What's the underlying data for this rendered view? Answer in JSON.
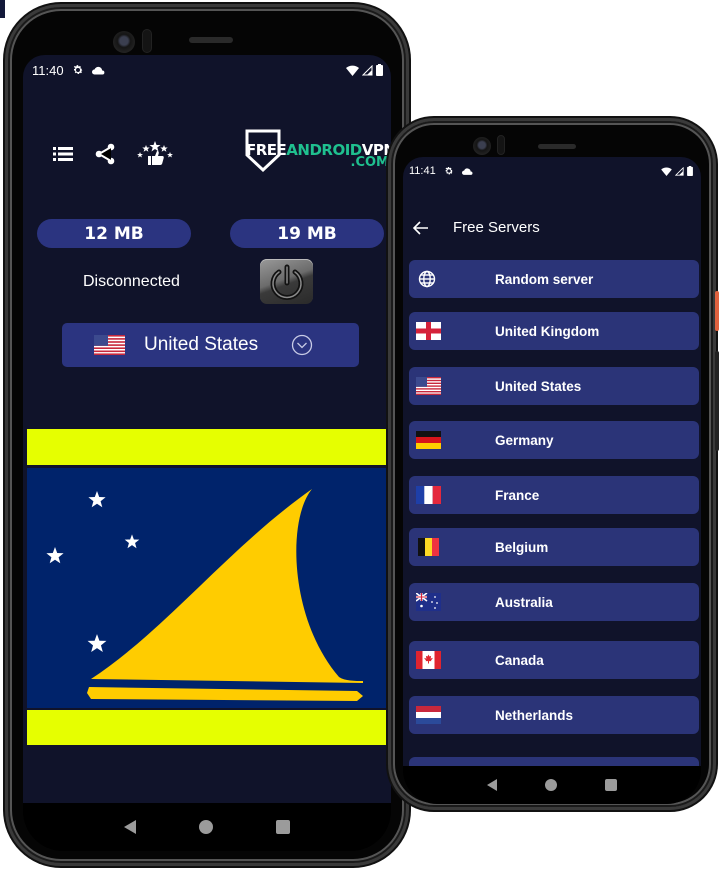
{
  "colors": {
    "screen_bg": "#10132a",
    "accent_blue": "#2b3480",
    "logo_green": "#1fc08f",
    "flag_yellow_bar": "#e6ff00",
    "flag_blue": "#00236b",
    "flag_gold": "#ffcc00"
  },
  "phone_main": {
    "statusbar": {
      "time": "11:40",
      "icons": [
        "settings-icon",
        "cloud-icon",
        "wifi-icon",
        "signal-icon",
        "battery-icon"
      ]
    },
    "toolbar": {
      "icons": [
        "list-icon",
        "share-icon",
        "rate-icon"
      ]
    },
    "logo": {
      "part1": "FREE",
      "part2": "ANDROID",
      "part3": "VPN",
      "suffix": ".COM"
    },
    "stats": {
      "download": "12 MB",
      "upload": "19 MB"
    },
    "connection_status": "Disconnected",
    "power_icon": "power-icon",
    "selected_country": {
      "name": "United States",
      "flag": "us-flag"
    },
    "displayed_flag": "tokelau-flag",
    "navbar": [
      "back",
      "home",
      "recents"
    ]
  },
  "phone_servers": {
    "statusbar": {
      "time": "11:41"
    },
    "header": {
      "title": "Free Servers",
      "back_icon": "arrow-left-icon"
    },
    "servers": [
      {
        "label": "Random server",
        "icon": "globe-icon"
      },
      {
        "label": "United Kingdom",
        "icon": "england-flag"
      },
      {
        "label": "United States",
        "icon": "us-flag"
      },
      {
        "label": "Germany",
        "icon": "germany-flag"
      },
      {
        "label": "France",
        "icon": "france-flag"
      },
      {
        "label": "Belgium",
        "icon": "belgium-flag"
      },
      {
        "label": "Australia",
        "icon": "australia-flag"
      },
      {
        "label": "Canada",
        "icon": "canada-flag"
      },
      {
        "label": "Netherlands",
        "icon": "netherlands-flag"
      },
      {
        "label": "",
        "icon": ""
      }
    ]
  }
}
